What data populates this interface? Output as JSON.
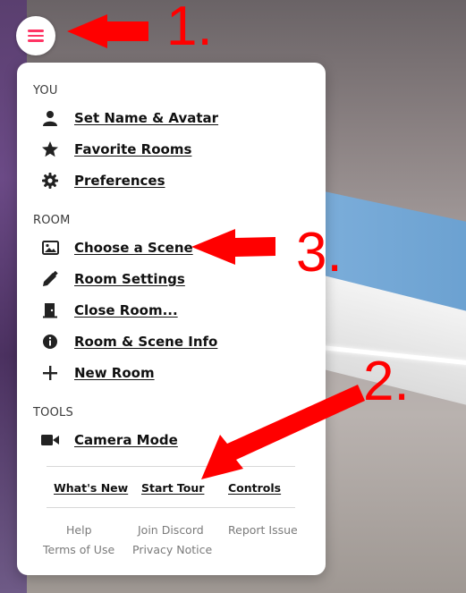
{
  "menu": {
    "sections": [
      {
        "title": "YOU",
        "items": [
          {
            "label": "Set Name & Avatar",
            "icon": "person-icon"
          },
          {
            "label": "Favorite Rooms",
            "icon": "star-icon"
          },
          {
            "label": "Preferences",
            "icon": "gear-icon"
          }
        ]
      },
      {
        "title": "ROOM",
        "items": [
          {
            "label": "Choose a Scene",
            "icon": "image-icon"
          },
          {
            "label": "Room Settings",
            "icon": "pencil-icon"
          },
          {
            "label": "Close Room...",
            "icon": "door-icon"
          },
          {
            "label": "Room & Scene Info",
            "icon": "info-icon"
          },
          {
            "label": "New Room",
            "icon": "plus-icon"
          }
        ]
      },
      {
        "title": "TOOLS",
        "items": [
          {
            "label": "Camera Mode",
            "icon": "video-camera-icon"
          }
        ]
      }
    ],
    "links": [
      "What's New",
      "Start Tour",
      "Controls"
    ],
    "footer": [
      "Help",
      "Join Discord",
      "Report Issue",
      "Terms of Use",
      "Privacy Notice"
    ]
  },
  "annotations": {
    "one": "1.",
    "two": "2.",
    "three": "3.",
    "color": "#ff0000"
  },
  "colors": {
    "menu_icon": "#ff3464",
    "panel_bg": "#ffffff"
  }
}
